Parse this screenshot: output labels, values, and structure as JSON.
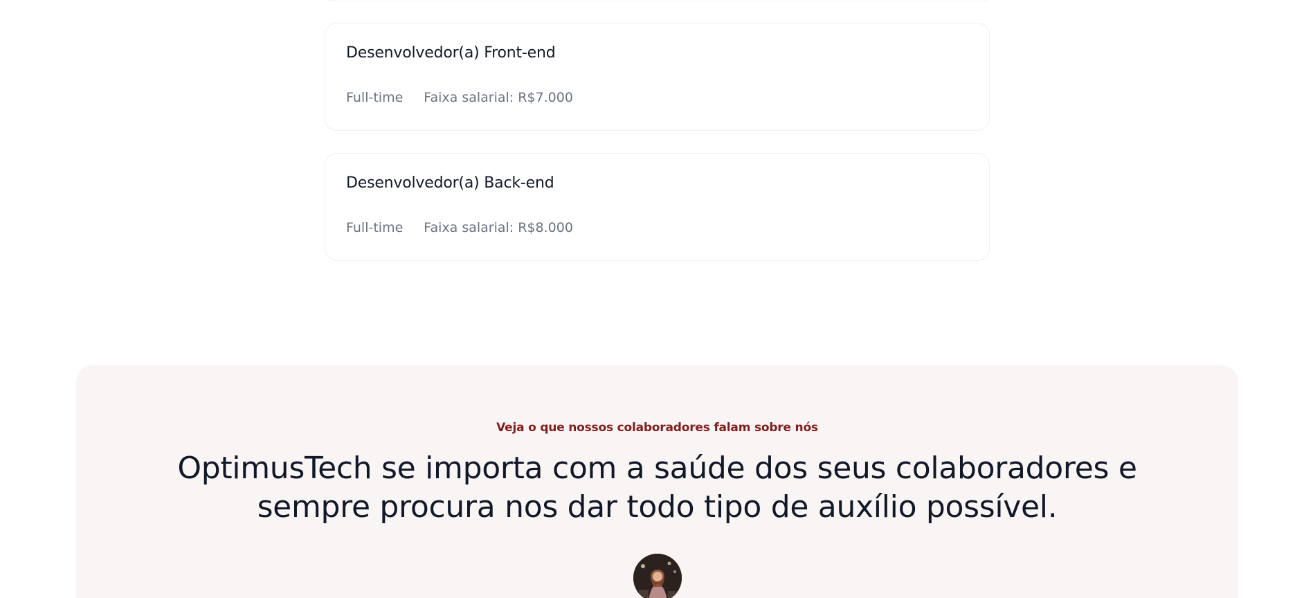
{
  "jobs": [
    {
      "title": "Desenvolvedor(a) Front-end",
      "type": "Full-time",
      "salary": "Faixa salarial: R$7.000"
    },
    {
      "title": "Desenvolvedor(a) Back-end",
      "type": "Full-time",
      "salary": "Faixa salarial: R$8.000"
    }
  ],
  "testimonials": {
    "eyebrow": "Veja o que nossos colaboradores falam sobre nós",
    "headline": "OptimusTech se importa com a saúde dos seus colaboradores e sempre procura nos dar todo tipo de auxílio possível.",
    "avatar_icon": "person-photo-icon"
  },
  "colors": {
    "accent": "#7f1d1d",
    "section_bg": "#faf5f5",
    "text_primary": "#111827",
    "text_muted": "#6b7280"
  }
}
